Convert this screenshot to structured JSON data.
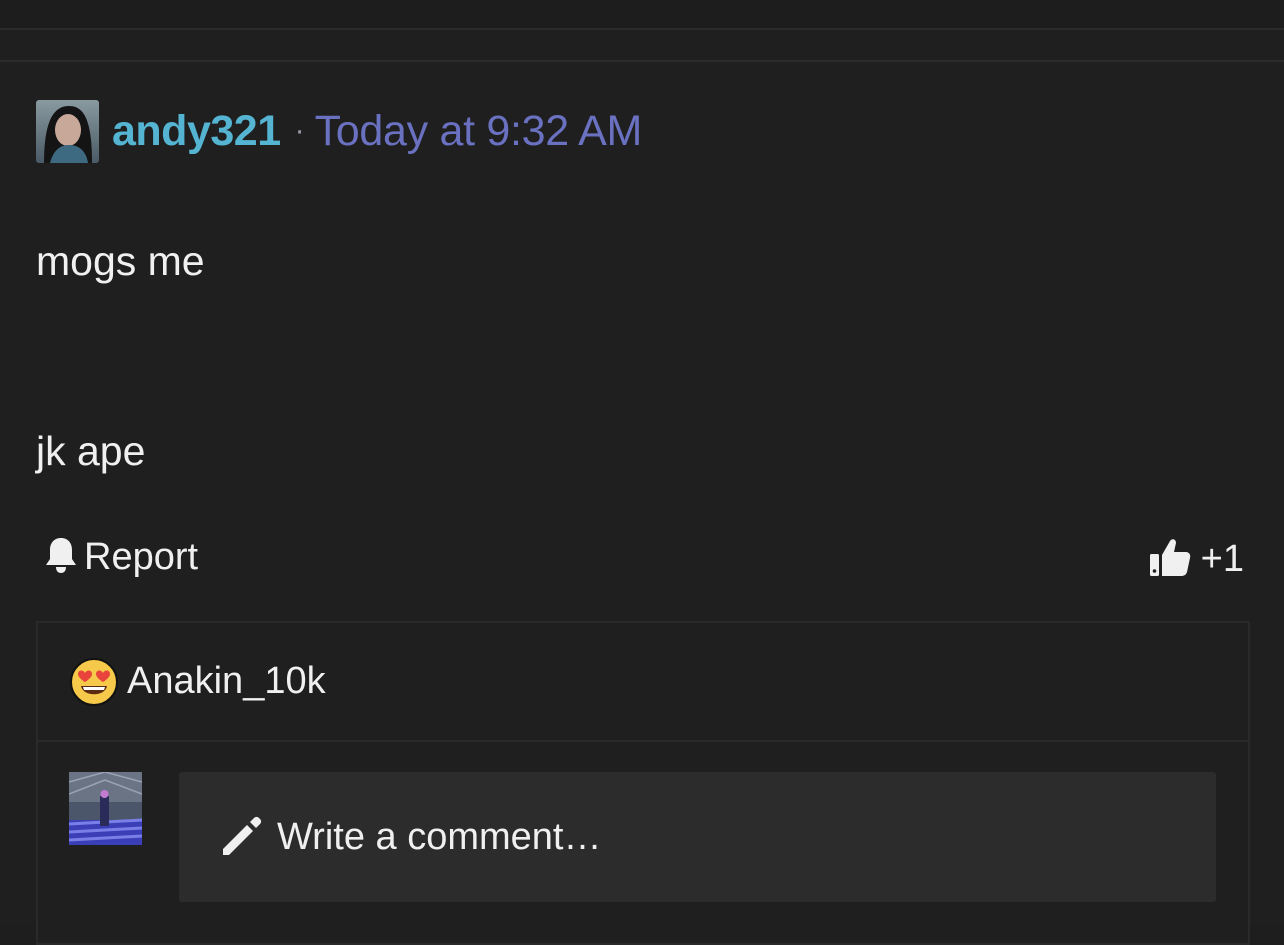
{
  "post": {
    "username": "andy321",
    "separator": "·",
    "timestamp": "Today at 9:32 AM",
    "lines": [
      "mogs me",
      "jk ape"
    ]
  },
  "actions": {
    "report_label": "Report",
    "like_count": "+1"
  },
  "reactions": {
    "reactor_name": "Anakin_10k",
    "reactor_emoji": "heart-eyes-emoji"
  },
  "comment": {
    "placeholder": "Write a comment…"
  },
  "icons": {
    "report": "bell-icon",
    "like": "thumbs-up-icon",
    "comment": "pencil-icon"
  },
  "colors": {
    "username": "#55b4d1",
    "timestamp": "#6a71c0",
    "background": "#1f1f20"
  }
}
